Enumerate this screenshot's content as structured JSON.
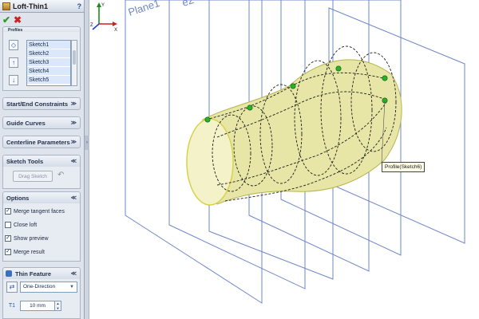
{
  "pm": {
    "title": "Loft-Thin1",
    "help": "?",
    "ok": "✔",
    "cancel": "✖",
    "profiles_group_label": "Profiles",
    "profiles": [
      "Sketch1",
      "Sketch2",
      "Sketch3",
      "Sketch4",
      "Sketch5"
    ],
    "sections": {
      "start_end": "Start/End Constraints",
      "guide_curves": "Guide Curves",
      "centerline": "Centerline Parameters",
      "sketch_tools": "Sketch Tools",
      "options": "Options",
      "thin_feature": "Thin Feature"
    },
    "collapse_chevron": "≫",
    "expand_chevron": "≪",
    "drag_sketch": "Drag Sketch",
    "options": [
      {
        "label": "Merge tangent faces",
        "checked": true
      },
      {
        "label": "Close loft",
        "checked": false
      },
      {
        "label": "Show preview",
        "checked": true
      },
      {
        "label": "Merge result",
        "checked": true
      }
    ],
    "thin": {
      "direction": "One-Direction",
      "thickness": "10 mm"
    }
  },
  "viewport": {
    "plane_label_1": "Plane1",
    "plane_label_2": "e2",
    "callout": "Profile(Sketch6)",
    "colors": {
      "plane": "#6f87c9",
      "body_fill": "#e8e6a6",
      "body_edge": "#b5b44a",
      "curve": "#1e1e1e",
      "point": "#27b227"
    }
  }
}
